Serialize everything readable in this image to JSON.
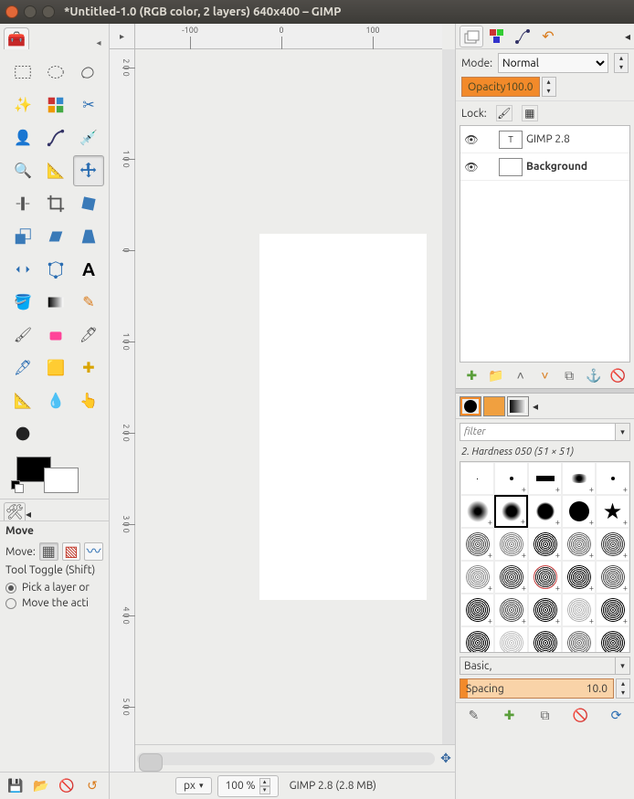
{
  "window": {
    "title": "*Untitled-1.0 (RGB color, 2 layers) 640x400 – GIMP"
  },
  "hruler": {
    "m100": "-100",
    "z": "0",
    "p100": "100"
  },
  "vruler": {
    "d200": "2\n0\n0",
    "d100": "1\n0\n0",
    "d0": "0",
    "d_100": "1\n0\n0",
    "d_200": "2\n0\n0",
    "d_300": "3\n0\n0",
    "d_400": "4\n0\n0",
    "d_500": "5\n0\n0"
  },
  "tool_options": {
    "title": "Move",
    "move_label": "Move:",
    "toggle_label": "Tool Toggle  (Shift)",
    "radio1": "Pick a layer or",
    "radio2": "Move the acti"
  },
  "status": {
    "unit": "px",
    "zoom": "100 %",
    "info": "GIMP 2.8 (2.8 MB)"
  },
  "layers": {
    "mode_label": "Mode:",
    "mode_value": "Normal",
    "opacity_label": "Opacity",
    "opacity_value": "100.0",
    "lock_label": "Lock:",
    "items": [
      {
        "name": "GIMP 2.8",
        "thumb": "T"
      },
      {
        "name": "Background",
        "thumb": ""
      }
    ]
  },
  "brushes": {
    "filter_placeholder": "filter",
    "current": "2. Hardness 050 (51 × 51)",
    "category": "Basic,",
    "spacing_label": "Spacing",
    "spacing_value": "10.0"
  }
}
